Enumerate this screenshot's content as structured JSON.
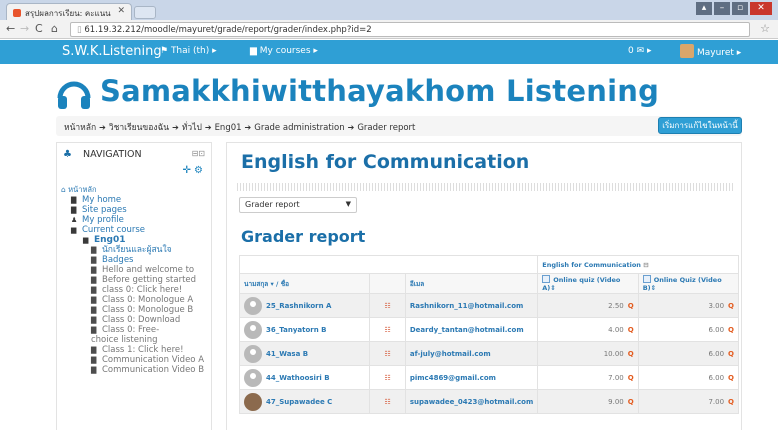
{
  "browser": {
    "tab_title": "สรุปผลการเรียน: คะแนน",
    "url": "61.19.32.212/moodle/mayuret/grade/report/grader/index.php?id=2"
  },
  "topnav": {
    "brand": "S.W.K.Listening",
    "language": "Thai (th) ▸",
    "my_courses": "My courses ▸",
    "messages": "0 ✉ ▸",
    "user": "Mayuret ▸"
  },
  "header": {
    "site_title": "Samakkhiwitthayakhom Listening"
  },
  "breadcrumb": {
    "items": [
      "หน้าหลัก",
      "วิชาเรียนของฉัน",
      "ทั่วไป",
      "Eng01",
      "Grade administration",
      "Grader report"
    ],
    "edit_button": "เริ่มการแก้ไขในหน้านี้"
  },
  "navigation": {
    "title": "NAVIGATION",
    "home": "หน้าหลัก",
    "items": [
      {
        "label": "My home",
        "level": "l2",
        "icon": "▇"
      },
      {
        "label": "Site pages",
        "level": "l2",
        "icon": "▇"
      },
      {
        "label": "My profile",
        "level": "l2",
        "icon": "♟"
      },
      {
        "label": "Current course",
        "level": "l2",
        "icon": "▆"
      },
      {
        "label": "Eng01",
        "level": "l3",
        "icon": "▆"
      },
      {
        "label": "นักเรียนและผู้สนใจ",
        "level": "l4b",
        "icon": "▇"
      },
      {
        "label": "Badges",
        "level": "l4b",
        "icon": "▇"
      },
      {
        "label": "Hello and welcome to",
        "level": "l4",
        "icon": "▇"
      },
      {
        "label": "Before getting started",
        "level": "l4",
        "icon": "▇"
      },
      {
        "label": "class 0: Click here!",
        "level": "l4",
        "icon": "▇"
      },
      {
        "label": "Class 0: Monologue A",
        "level": "l4",
        "icon": "▇"
      },
      {
        "label": "Class 0: Monologue B",
        "level": "l4",
        "icon": "▇"
      },
      {
        "label": "Class 0: Download",
        "level": "l4",
        "icon": "▇"
      },
      {
        "label": "Class 0: Free-choice listening",
        "level": "l4w",
        "icon": "▇"
      },
      {
        "label": "Class 1: Click here!",
        "level": "l4",
        "icon": "▇"
      },
      {
        "label": "Communication Video A",
        "level": "l4",
        "icon": "▇"
      },
      {
        "label": "Communication Video B",
        "level": "l4",
        "icon": "▇"
      }
    ]
  },
  "main": {
    "course_title": "English for Communication",
    "report_select": "Grader report",
    "report_title": "Grader report",
    "category_header": "English for Communication",
    "columns": {
      "surname": "นามสกุล ▾",
      "firstname": "ชื่อ",
      "email": "อีเมล",
      "item_a": "Online quiz (Video A)",
      "item_b": "Online Quiz (Video B)"
    },
    "rows": [
      {
        "name": "25_Rashnikorn A",
        "email": "Rashnikorn_11@hotmail.com",
        "a": "2.50",
        "b": "3.00"
      },
      {
        "name": "36_Tanyatorn B",
        "email": "Deardy_tantan@hotmail.com",
        "a": "4.00",
        "b": "6.00"
      },
      {
        "name": "41_Wasa B",
        "email": "af-july@hotmail.com",
        "a": "10.00",
        "b": "6.00"
      },
      {
        "name": "44_Wathoosiri B",
        "email": "pimc4869@gmail.com",
        "a": "7.00",
        "b": "6.00"
      },
      {
        "name": "47_Supawadee C",
        "email": "supawadee_0423@hotmail.com",
        "a": "9.00",
        "b": "7.00"
      }
    ]
  }
}
